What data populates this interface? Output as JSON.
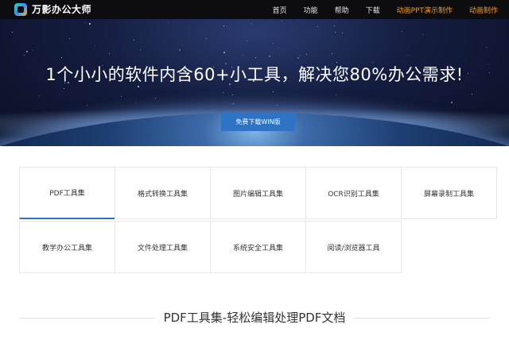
{
  "nav": {
    "logo_text": "万影办公大师",
    "items": [
      "首页",
      "功能",
      "帮助",
      "下载",
      "动画PPT演示制作",
      "动画制作"
    ]
  },
  "hero": {
    "title": "1个小小的软件内含60+小工具，解决您80%办公需求!",
    "button_label": "免费下载WIN版"
  },
  "categories": [
    "PDF工具集",
    "格式转换工具集",
    "图片编辑工具集",
    "OCR识别工具集",
    "屏幕录制工具集",
    "教学办公工具集",
    "文件处理工具集",
    "系统安全工具集",
    "阅读/浏览器工具"
  ],
  "section": {
    "title": "PDF工具集-轻松编辑处理PDF文档"
  },
  "colors": {
    "nav_bg": "#0d0d10",
    "accent_blue": "#2f74c4",
    "accent_orange": "#f29a32"
  }
}
